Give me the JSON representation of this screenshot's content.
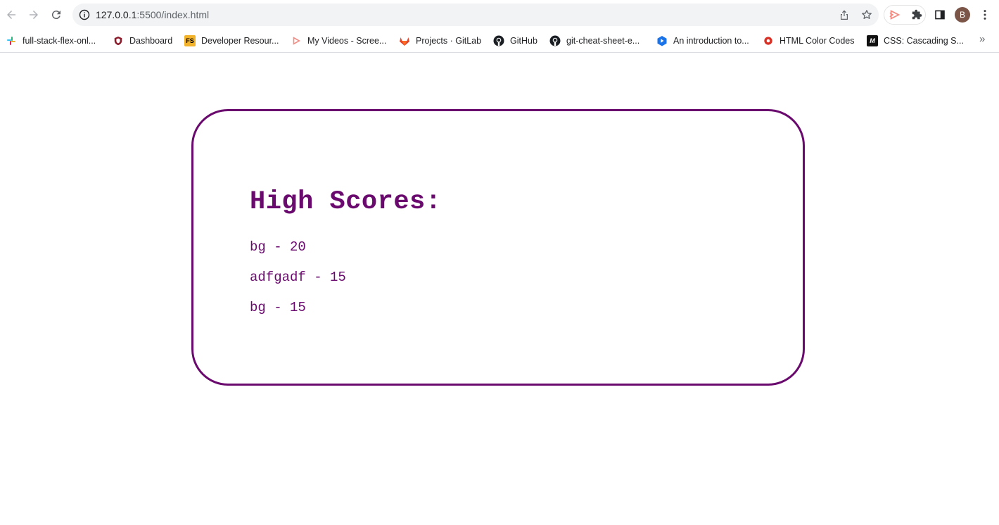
{
  "browser": {
    "url_host": "127.0.0.1",
    "url_path": ":5500/index.html",
    "avatar_letter": "B",
    "icons": {
      "back": "arrow-left-icon",
      "forward": "arrow-right-icon",
      "reload": "reload-icon",
      "info": "info-icon",
      "share": "share-icon",
      "bookmark": "star-icon",
      "extension": "puzzle-icon",
      "sidepanel": "side-panel-icon",
      "menu": "kebab-menu-icon"
    }
  },
  "bookmarks": [
    {
      "label": "full-stack-flex-onl...",
      "icon": "slack-icon"
    },
    {
      "label": "Dashboard",
      "icon": "shield-icon"
    },
    {
      "label": "Developer Resour...",
      "icon": "fs-icon"
    },
    {
      "label": "My Videos - Scree...",
      "icon": "screencast-icon"
    },
    {
      "label": "Projects · GitLab",
      "icon": "gitlab-icon"
    },
    {
      "label": "GitHub",
      "icon": "github-icon"
    },
    {
      "label": "git-cheat-sheet-e...",
      "icon": "github-icon"
    },
    {
      "label": "An introduction to...",
      "icon": "play-icon"
    },
    {
      "label": "HTML Color Codes",
      "icon": "color-wheel-icon"
    },
    {
      "label": "CSS: Cascading S...",
      "icon": "mdn-icon"
    }
  ],
  "bookmarks_overflow": "»",
  "page": {
    "title": "High Scores:",
    "scores": [
      "bg - 20",
      "adfgadf - 15",
      "bg - 15"
    ],
    "accent_color": "#6a0a6e"
  }
}
